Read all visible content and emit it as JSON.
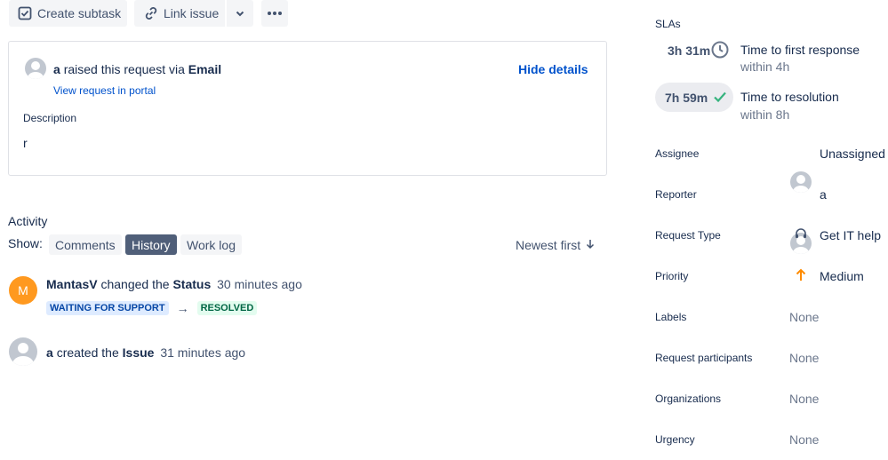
{
  "toolbar": {
    "create_subtask": "Create subtask",
    "link_issue": "Link issue"
  },
  "request": {
    "reporter": "a",
    "raised_text": "raised this request via",
    "channel": "Email",
    "view_portal": "View request in portal",
    "hide_details": "Hide details",
    "description_label": "Description",
    "description_value": "r"
  },
  "activity": {
    "title": "Activity",
    "show_label": "Show:",
    "tabs": [
      "Comments",
      "History",
      "Work log"
    ],
    "active_tab": "History",
    "sort": "Newest first",
    "entries": [
      {
        "avatar_initial": "M",
        "user": "MantasV",
        "action": "changed the",
        "field": "Status",
        "time": "30 minutes ago",
        "from": "WAITING FOR SUPPORT",
        "arrow": "→",
        "to": "RESOLVED"
      },
      {
        "user": "a",
        "action": "created the",
        "field": "Issue",
        "time": "31 minutes ago"
      }
    ]
  },
  "sidebar": {
    "slas_title": "SLAs",
    "slas": [
      {
        "time": "3h 31m",
        "name": "Time to first response",
        "goal": "within 4h",
        "status_icon": "clock-icon"
      },
      {
        "time": "7h 59m",
        "name": "Time to resolution",
        "goal": "within 8h",
        "status_icon": "check-icon"
      }
    ],
    "fields": {
      "assignee": {
        "label": "Assignee",
        "value": "Unassigned"
      },
      "reporter": {
        "label": "Reporter",
        "value": "a"
      },
      "request_type": {
        "label": "Request Type",
        "value": "Get IT help"
      },
      "priority": {
        "label": "Priority",
        "value": "Medium"
      },
      "labels": {
        "label": "Labels",
        "value": "None"
      },
      "request_participants": {
        "label": "Request participants",
        "value": "None"
      },
      "organizations": {
        "label": "Organizations",
        "value": "None"
      },
      "urgency": {
        "label": "Urgency",
        "value": "None"
      }
    }
  },
  "colors": {
    "link": "#0052cc",
    "status_blue_bg": "#deebff",
    "status_blue_text": "#0747a6",
    "status_green_bg": "#e3fcef",
    "status_green_text": "#006644",
    "priority_medium": "#ff8b00",
    "avatar_orange": "#ff991f",
    "sla_check": "#36b37e"
  }
}
